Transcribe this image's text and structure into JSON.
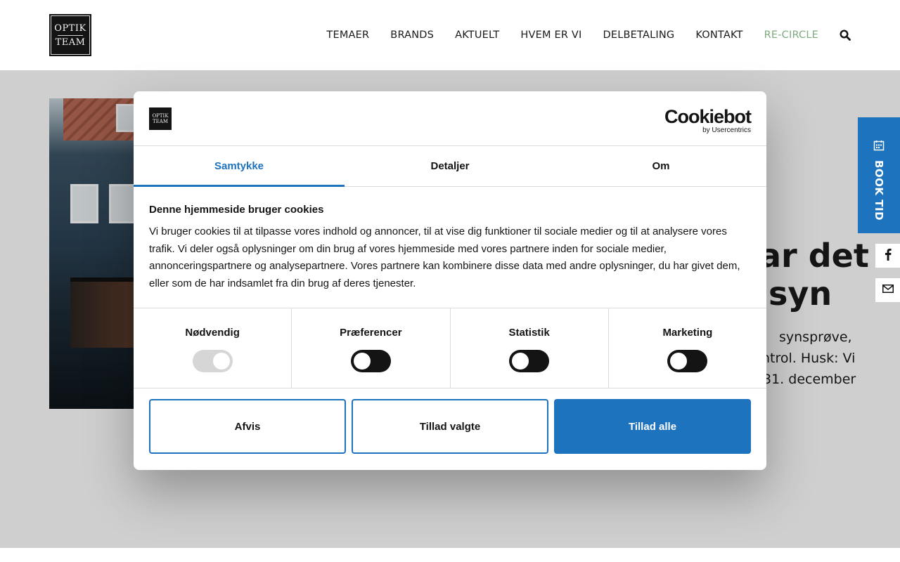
{
  "header": {
    "logo": {
      "line1": "OPTIK",
      "line2": "TEAM"
    },
    "nav": [
      {
        "label": "TEMAER"
      },
      {
        "label": "BRANDS"
      },
      {
        "label": "AKTUELT"
      },
      {
        "label": "HVEM ER VI"
      },
      {
        "label": "DELBETALING"
      },
      {
        "label": "KONTAKT"
      },
      {
        "label": "RE-CIRCLE",
        "color": "#7faa7f"
      }
    ],
    "search_icon": "search-icon"
  },
  "hero": {
    "title_line1": "ar det",
    "title_line2": "syn",
    "text_line1": "synsprøve,",
    "text_line2": "ntrol. Husk: Vi",
    "text_line3": "31. december"
  },
  "side": {
    "book_label": "BOOK TID",
    "book_icon": "calendar-icon",
    "facebook_icon": "facebook-icon",
    "mail_icon": "mail-icon"
  },
  "cookie": {
    "logo": {
      "line1": "OPTIK",
      "line2": "TEAM"
    },
    "brand": "Cookiebot",
    "brand_sub": "by Usercentrics",
    "tabs": [
      {
        "label": "Samtykke",
        "active": true
      },
      {
        "label": "Detaljer",
        "active": false
      },
      {
        "label": "Om",
        "active": false
      }
    ],
    "title": "Denne hjemmeside bruger cookies",
    "text": "Vi bruger cookies til at tilpasse vores indhold og annoncer, til at vise dig funktioner til sociale medier og til at analysere vores trafik. Vi deler også oplysninger om din brug af vores hjemmeside med vores partnere inden for sociale medier, annonceringspartnere og analysepartnere. Vores partnere kan kombinere disse data med andre oplysninger, du har givet dem, eller som de har indsamlet fra din brug af deres tjenester.",
    "toggles": [
      {
        "label": "Nødvendig",
        "state": "on-disabled"
      },
      {
        "label": "Præferencer",
        "state": "off"
      },
      {
        "label": "Statistik",
        "state": "off"
      },
      {
        "label": "Marketing",
        "state": "off"
      }
    ],
    "buttons": {
      "reject": "Afvis",
      "allow_selected": "Tillad valgte",
      "allow_all": "Tillad alle"
    }
  },
  "colors": {
    "accent_blue": "#1e73be",
    "nav_accent_green": "#7faa7f",
    "dark": "#141414"
  }
}
